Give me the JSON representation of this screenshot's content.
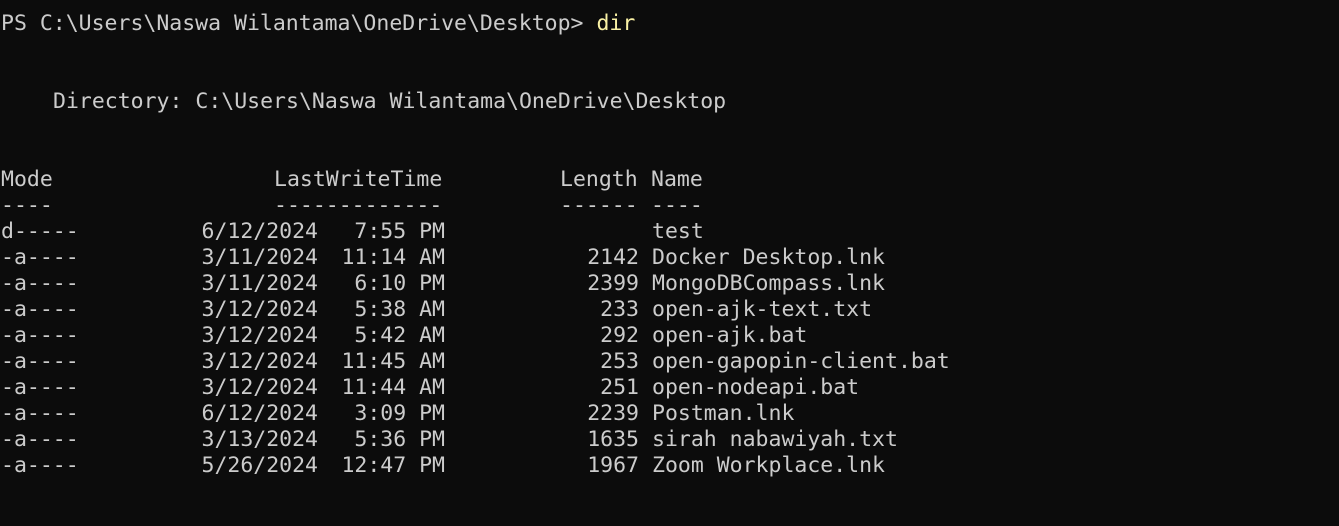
{
  "prompt": {
    "prefix": "PS C:\\Users\\Naswa Wilantama\\OneDrive\\Desktop> ",
    "command": "dir"
  },
  "directory_line": "Directory: C:\\Users\\Naswa Wilantama\\OneDrive\\Desktop",
  "header": {
    "mode": "Mode",
    "lastwritetime": "LastWriteTime",
    "length": "Length",
    "name": "Name"
  },
  "underline": {
    "mode": "----",
    "lastwritetime": "-------------",
    "length": "------",
    "name": "----"
  },
  "rows": [
    {
      "mode": "d-----",
      "date": "6/12/2024",
      "time": "7:55 PM",
      "length": "",
      "name": "test"
    },
    {
      "mode": "-a----",
      "date": "3/11/2024",
      "time": "11:14 AM",
      "length": "2142",
      "name": "Docker Desktop.lnk"
    },
    {
      "mode": "-a----",
      "date": "3/11/2024",
      "time": "6:10 PM",
      "length": "2399",
      "name": "MongoDBCompass.lnk"
    },
    {
      "mode": "-a----",
      "date": "3/12/2024",
      "time": "5:38 AM",
      "length": "233",
      "name": "open-ajk-text.txt"
    },
    {
      "mode": "-a----",
      "date": "3/12/2024",
      "time": "5:42 AM",
      "length": "292",
      "name": "open-ajk.bat"
    },
    {
      "mode": "-a----",
      "date": "3/12/2024",
      "time": "11:45 AM",
      "length": "253",
      "name": "open-gapopin-client.bat"
    },
    {
      "mode": "-a----",
      "date": "3/12/2024",
      "time": "11:44 AM",
      "length": "251",
      "name": "open-nodeapi.bat"
    },
    {
      "mode": "-a----",
      "date": "6/12/2024",
      "time": "3:09 PM",
      "length": "2239",
      "name": "Postman.lnk"
    },
    {
      "mode": "-a----",
      "date": "3/13/2024",
      "time": "5:36 PM",
      "length": "1635",
      "name": "sirah nabawiyah.txt"
    },
    {
      "mode": "-a----",
      "date": "5/26/2024",
      "time": "12:47 PM",
      "length": "1967",
      "name": "Zoom Workplace.lnk"
    }
  ]
}
